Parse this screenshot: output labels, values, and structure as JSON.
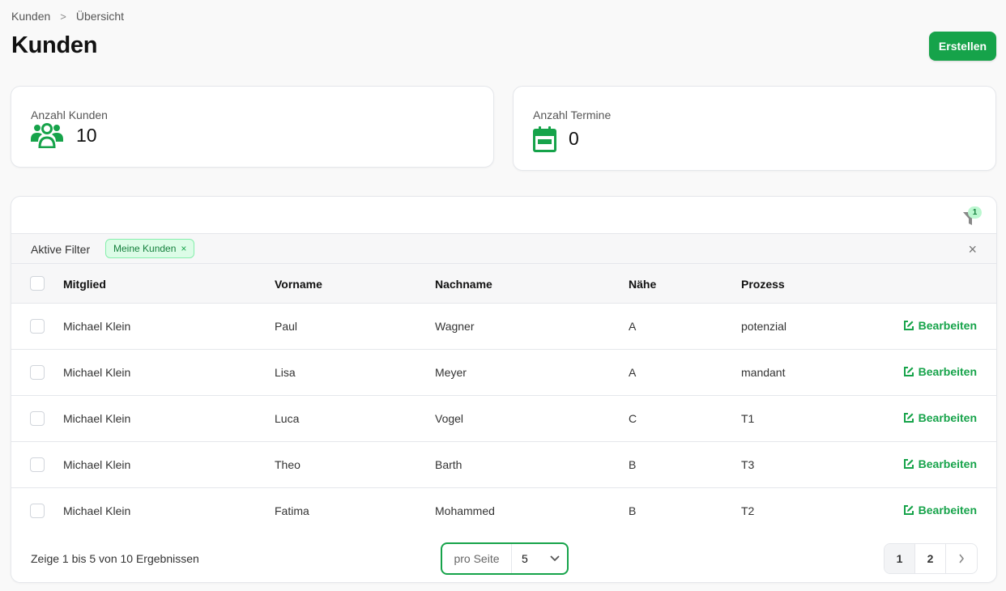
{
  "breadcrumb": {
    "items": [
      "Kunden",
      "Übersicht"
    ],
    "separator": ">"
  },
  "page": {
    "title": "Kunden"
  },
  "actions": {
    "create_label": "Erstellen"
  },
  "stats": [
    {
      "label": "Anzahl Kunden",
      "value": "10",
      "icon": "users-icon"
    },
    {
      "label": "Anzahl Termine",
      "value": "0",
      "icon": "calendar-icon"
    }
  ],
  "filters": {
    "count": "1",
    "active_label": "Aktive Filter",
    "chips": [
      {
        "label": "Meine Kunden",
        "remove": "×"
      }
    ],
    "clear": "×"
  },
  "table": {
    "columns": [
      "Mitglied",
      "Vorname",
      "Nachname",
      "Nähe",
      "Prozess"
    ],
    "edit_label": "Bearbeiten",
    "rows": [
      [
        "Michael Klein",
        "Paul",
        "Wagner",
        "A",
        "potenzial"
      ],
      [
        "Michael Klein",
        "Lisa",
        "Meyer",
        "A",
        "mandant"
      ],
      [
        "Michael Klein",
        "Luca",
        "Vogel",
        "C",
        "T1"
      ],
      [
        "Michael Klein",
        "Theo",
        "Barth",
        "B",
        "T3"
      ],
      [
        "Michael Klein",
        "Fatima",
        "Mohammed",
        "B",
        "T2"
      ]
    ]
  },
  "footer": {
    "result_text": "Zeige 1 bis 5 von 10 Ergebnissen",
    "per_page_label": "pro Seite",
    "per_page_value": "5",
    "pages": [
      "1",
      "2"
    ],
    "current_page": "1"
  },
  "colors": {
    "accent": "#16a34a",
    "chip_bg": "#dcfce7"
  }
}
